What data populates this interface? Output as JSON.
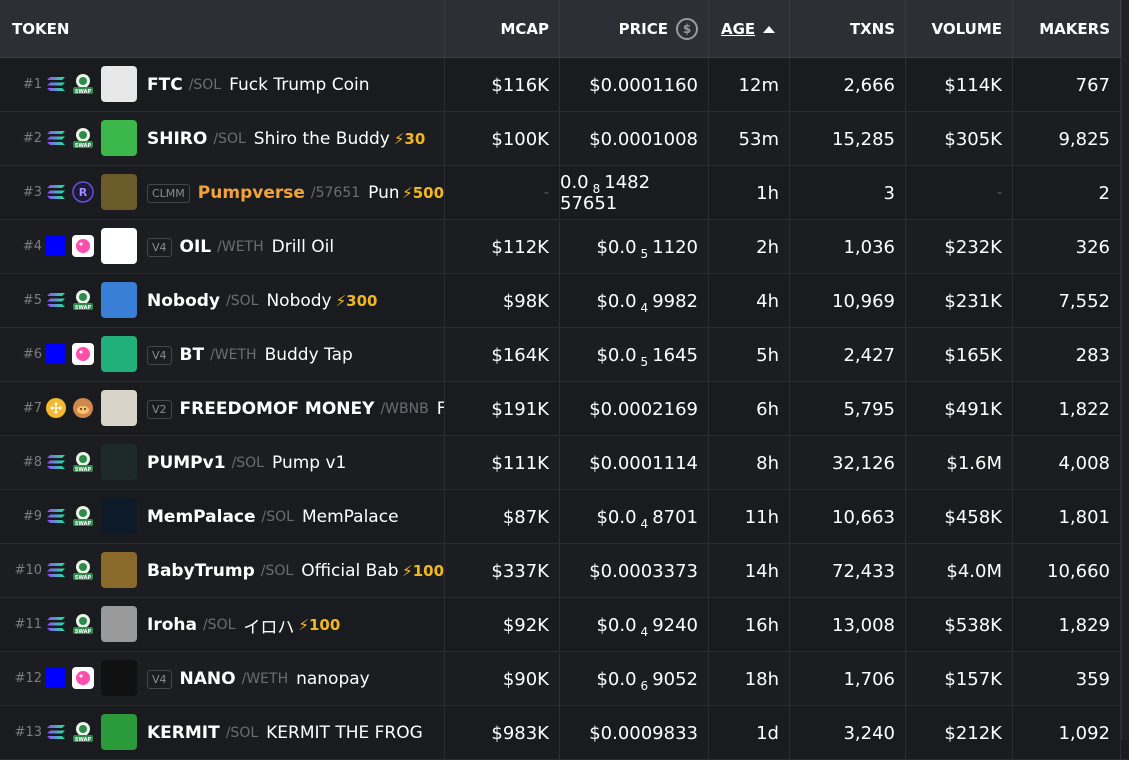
{
  "header": {
    "token": "TOKEN",
    "mcap": "MCAP",
    "price": "PRICE",
    "price_icon": "$",
    "age": "AGE",
    "txns": "TXNS",
    "volume": "VOLUME",
    "makers": "MAKERS"
  },
  "rows": [
    {
      "rank": "#1",
      "chain": "solana-icon",
      "dex": "swap-icon",
      "badge": "",
      "symbol": "FTC",
      "pair": "/SOL",
      "name": "Fuck Trump Coin",
      "boost": "",
      "mcap": "$116K",
      "price": "$0.0001160",
      "price_pre": "",
      "price_sub": "",
      "price_post": "",
      "age": "12m",
      "txns": "2,666",
      "volume": "$114K",
      "makers": "767",
      "logo": "#e8e8e8"
    },
    {
      "rank": "#2",
      "chain": "solana-icon",
      "dex": "swap-icon",
      "badge": "",
      "symbol": "SHIRO",
      "pair": "/SOL",
      "name": "Shiro the Buddy",
      "boost": "⚡30",
      "mcap": "$100K",
      "price": "$0.0001008",
      "price_pre": "",
      "price_sub": "",
      "price_post": "",
      "age": "53m",
      "txns": "15,285",
      "volume": "$305K",
      "makers": "9,825",
      "logo": "#3cb84a"
    },
    {
      "rank": "#3",
      "chain": "solana-icon",
      "dex": "raydium-icon",
      "badge": "CLMM",
      "symbol": "Pumpverse",
      "pair": "/57651",
      "name": "Pum",
      "boost": "⚡500",
      "mcap": "-",
      "price": "",
      "price_pre": "0.0",
      "price_sub": "8",
      "price_post": "1482 57651",
      "age": "1h",
      "txns": "3",
      "volume": "-",
      "makers": "2",
      "logo": "#6b5a2a"
    },
    {
      "rank": "#4",
      "chain": "base-icon",
      "dex": "uniswap-icon",
      "badge": "V4",
      "symbol": "OIL",
      "pair": "/WETH",
      "name": "Drill Oil",
      "boost": "",
      "mcap": "$112K",
      "price": "",
      "price_pre": "$0.0",
      "price_sub": "5",
      "price_post": "1120",
      "age": "2h",
      "txns": "1,036",
      "volume": "$232K",
      "makers": "326",
      "logo": "#ffffff"
    },
    {
      "rank": "#5",
      "chain": "solana-icon",
      "dex": "swap-icon",
      "badge": "",
      "symbol": "Nobody",
      "pair": "/SOL",
      "name": "Nobody",
      "boost": "⚡300",
      "mcap": "$98K",
      "price": "",
      "price_pre": "$0.0",
      "price_sub": "4",
      "price_post": "9982",
      "age": "4h",
      "txns": "10,969",
      "volume": "$231K",
      "makers": "7,552",
      "logo": "#3a7fd6"
    },
    {
      "rank": "#6",
      "chain": "base-icon",
      "dex": "uniswap-icon",
      "badge": "V4",
      "symbol": "BT",
      "pair": "/WETH",
      "name": "Buddy Tap",
      "boost": "",
      "mcap": "$164K",
      "price": "",
      "price_pre": "$0.0",
      "price_sub": "5",
      "price_post": "1645",
      "age": "5h",
      "txns": "2,427",
      "volume": "$165K",
      "makers": "283",
      "logo": "#22b07a"
    },
    {
      "rank": "#7",
      "chain": "bnb-icon",
      "dex": "pancake-icon",
      "badge": "V2",
      "symbol": "FREEDOMOF MONEY",
      "pair": "/WBNB",
      "name": "Fre",
      "boost": "",
      "mcap": "$191K",
      "price": "$0.0002169",
      "price_pre": "",
      "price_sub": "",
      "price_post": "",
      "age": "6h",
      "txns": "5,795",
      "volume": "$491K",
      "makers": "1,822",
      "logo": "#d8d4c8"
    },
    {
      "rank": "#8",
      "chain": "solana-icon",
      "dex": "swap-icon",
      "badge": "",
      "symbol": "PUMPv1",
      "pair": "/SOL",
      "name": "Pump v1",
      "boost": "",
      "mcap": "$111K",
      "price": "$0.0001114",
      "price_pre": "",
      "price_sub": "",
      "price_post": "",
      "age": "8h",
      "txns": "32,126",
      "volume": "$1.6M",
      "makers": "4,008",
      "logo": "#1e2a2a"
    },
    {
      "rank": "#9",
      "chain": "solana-icon",
      "dex": "swap-icon",
      "badge": "",
      "symbol": "MemPalace",
      "pair": "/SOL",
      "name": "MemPalace",
      "boost": "",
      "mcap": "$87K",
      "price": "",
      "price_pre": "$0.0",
      "price_sub": "4",
      "price_post": "8701",
      "age": "11h",
      "txns": "10,663",
      "volume": "$458K",
      "makers": "1,801",
      "logo": "#0d1a2a"
    },
    {
      "rank": "#10",
      "chain": "solana-icon",
      "dex": "swap-icon",
      "badge": "",
      "symbol": "BabyTrump",
      "pair": "/SOL",
      "name": "Official Bab",
      "boost": "⚡100",
      "mcap": "$337K",
      "price": "$0.0003373",
      "price_pre": "",
      "price_sub": "",
      "price_post": "",
      "age": "14h",
      "txns": "72,433",
      "volume": "$4.0M",
      "makers": "10,660",
      "logo": "#8a6a2a"
    },
    {
      "rank": "#11",
      "chain": "solana-icon",
      "dex": "swap-icon",
      "badge": "",
      "symbol": "Iroha",
      "pair": "/SOL",
      "name": "イロハ",
      "boost": "⚡100",
      "mcap": "$92K",
      "price": "",
      "price_pre": "$0.0",
      "price_sub": "4",
      "price_post": "9240",
      "age": "16h",
      "txns": "13,008",
      "volume": "$538K",
      "makers": "1,829",
      "logo": "#9a9a9a"
    },
    {
      "rank": "#12",
      "chain": "base-icon",
      "dex": "uniswap-icon",
      "badge": "V4",
      "symbol": "NANO",
      "pair": "/WETH",
      "name": "nanopay",
      "boost": "",
      "mcap": "$90K",
      "price": "",
      "price_pre": "$0.0",
      "price_sub": "6",
      "price_post": "9052",
      "age": "18h",
      "txns": "1,706",
      "volume": "$157K",
      "makers": "359",
      "logo": "#111111"
    },
    {
      "rank": "#13",
      "chain": "solana-icon",
      "dex": "swap-icon",
      "badge": "",
      "symbol": "KERMIT",
      "pair": "/SOL",
      "name": "KERMIT THE FROG",
      "boost": "",
      "mcap": "$983K",
      "price": "$0.0009833",
      "price_pre": "",
      "price_sub": "",
      "price_post": "",
      "age": "1d",
      "txns": "3,240",
      "volume": "$212K",
      "makers": "1,092",
      "logo": "#2a9a3a"
    }
  ]
}
